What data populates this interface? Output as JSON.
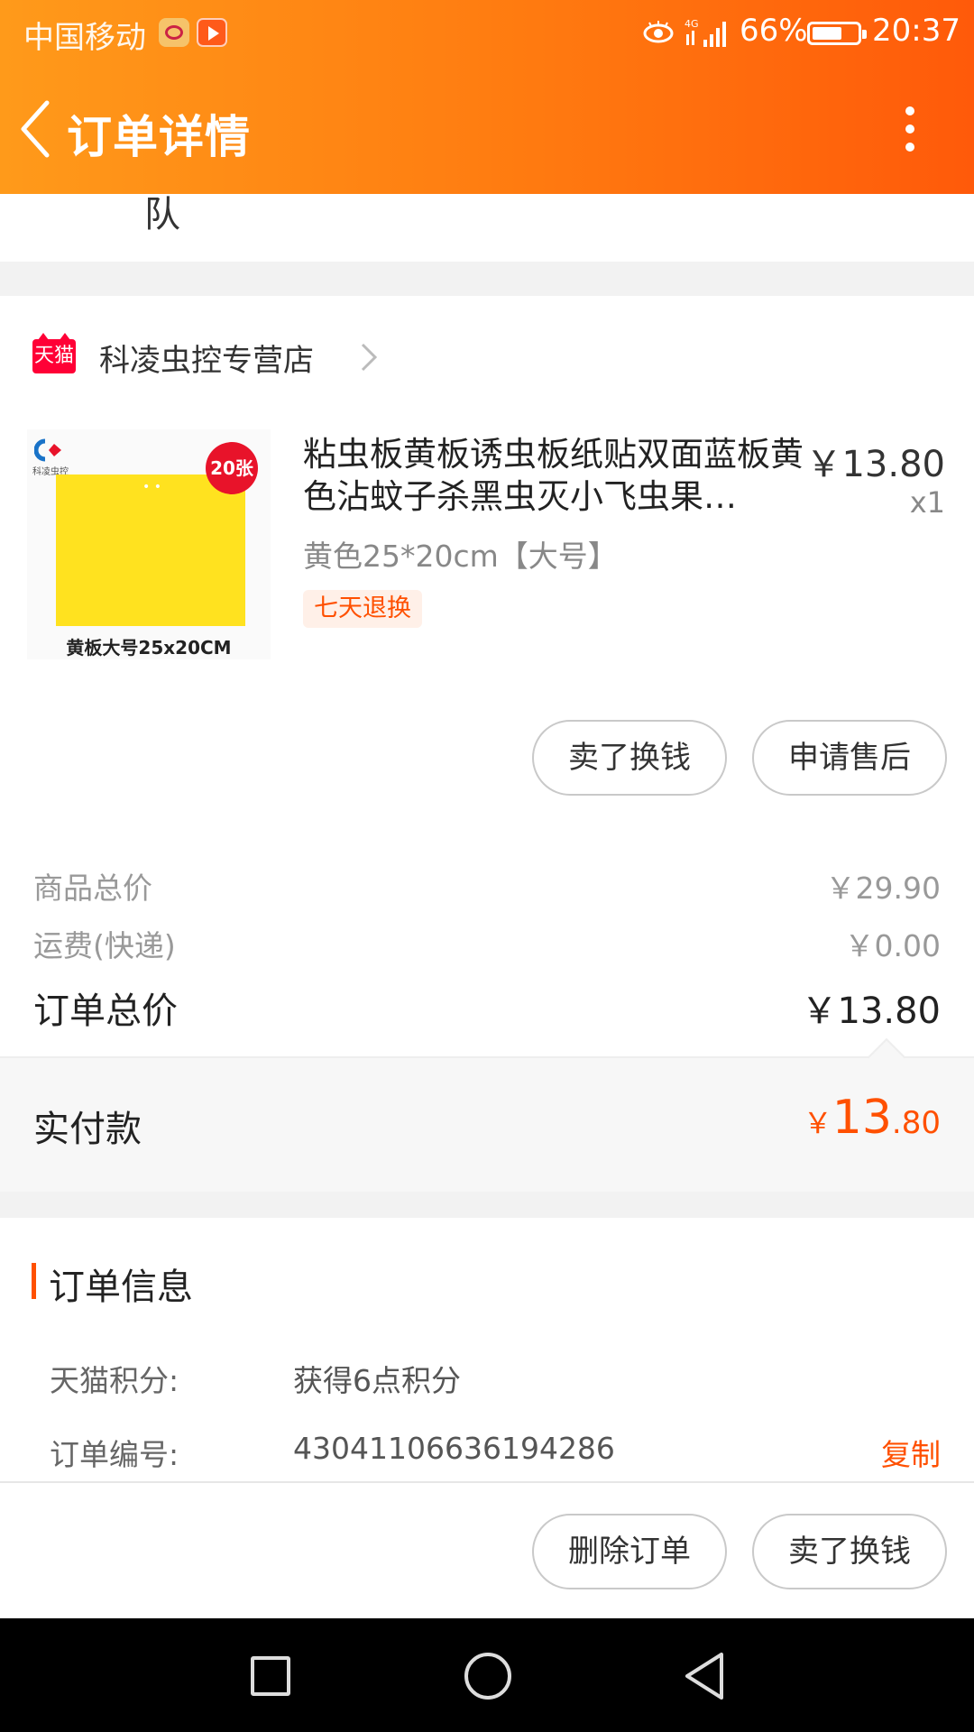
{
  "status_bar": {
    "carrier": "中国移动",
    "battery": "66%",
    "time": "20:37",
    "network": "4G"
  },
  "header": {
    "title": "订单详情"
  },
  "cut_text": "队",
  "shop": {
    "badge": "天猫",
    "name": "科凌虫控专营店"
  },
  "product": {
    "image": {
      "brand_text": "科凌虫控",
      "badge": "20张",
      "caption": "黄板大号25x20CM"
    },
    "title": "粘虫板黄板诱虫板纸贴双面蓝板黄色沾蚊子杀黑虫灭小飞虫果…",
    "price": "￥13.80",
    "quantity": "x1",
    "sku": "黄色25*20cm【大号】",
    "tag": "七天退换"
  },
  "item_actions": {
    "sell": "卖了换钱",
    "after_sale": "申请售后"
  },
  "summary": {
    "goods_label": "商品总价",
    "goods_value": "￥29.90",
    "shipping_label": "运费(快递)",
    "shipping_value": "￥0.00",
    "total_label": "订单总价",
    "total_value": "￥13.80",
    "paid_label": "实付款",
    "paid_currency": "￥",
    "paid_int": "13",
    "paid_dec": ".80"
  },
  "order_info": {
    "title": "订单信息",
    "points_label": "天猫积分:",
    "points_value": "获得6点积分",
    "order_no_label": "订单编号:",
    "order_no_value": "43041106636194286",
    "copy": "复制"
  },
  "bottom_actions": {
    "delete": "删除订单",
    "sell": "卖了换钱"
  },
  "colors": {
    "accent": "#ff5000",
    "header_start": "#ff9a1a",
    "header_end": "#ff5a0a",
    "tmall_red": "#ff0036"
  }
}
